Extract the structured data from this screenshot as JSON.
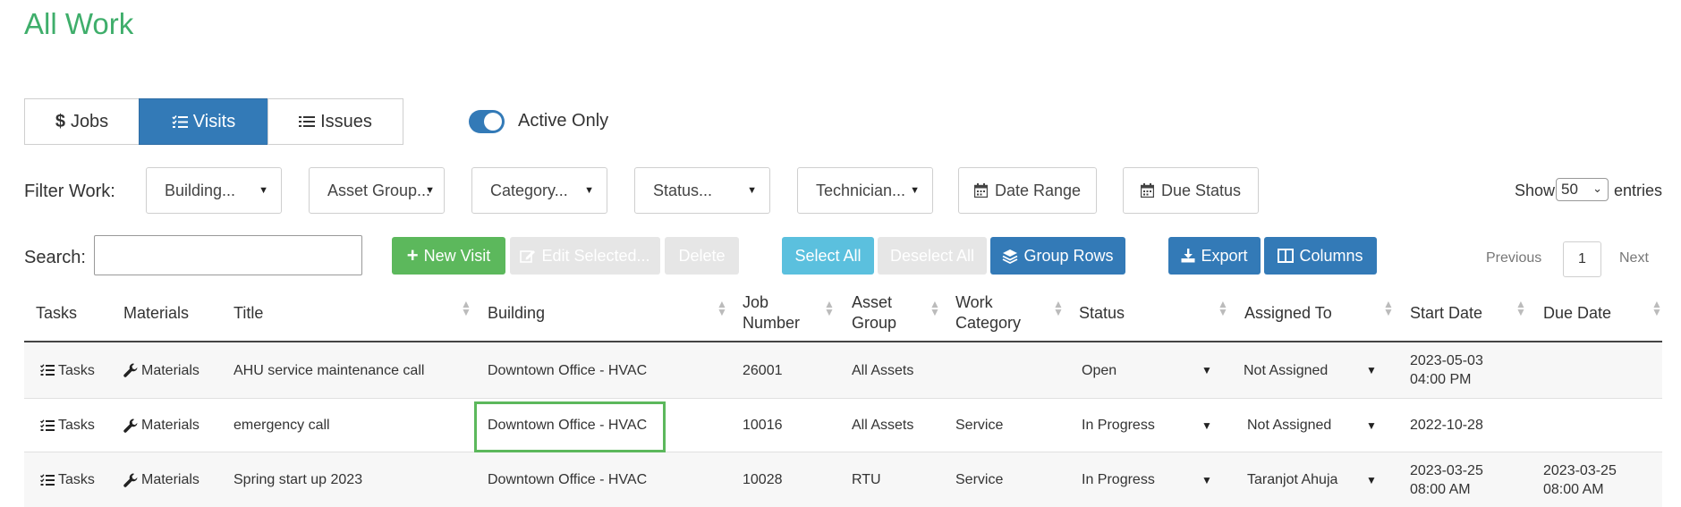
{
  "page_title": "All Work",
  "view_tabs": [
    {
      "label": "Jobs",
      "icon": "dollar-icon",
      "active": false
    },
    {
      "label": "Visits",
      "icon": "list-check-icon",
      "active": true
    },
    {
      "label": "Issues",
      "icon": "list-icon",
      "active": false
    }
  ],
  "active_only": {
    "label": "Active Only",
    "on": true
  },
  "filters": {
    "label": "Filter Work:",
    "building": "Building...",
    "asset_group": "Asset Group...",
    "category": "Category...",
    "status": "Status...",
    "technician": "Technician...",
    "date_range": "Date Range",
    "due_status": "Due Status"
  },
  "entries": {
    "show": "Show",
    "value": "50",
    "suffix": "entries"
  },
  "search": {
    "label": "Search:",
    "value": ""
  },
  "actions": {
    "new_visit": "New Visit",
    "edit_selected": "Edit Selected...",
    "delete": "Delete",
    "select_all": "Select All",
    "deselect_all": "Deselect All",
    "group_rows": "Group Rows",
    "export": "Export",
    "columns": "Columns"
  },
  "pagination": {
    "previous": "Previous",
    "page": "1",
    "next": "Next"
  },
  "columns": {
    "tasks": "Tasks",
    "materials": "Materials",
    "title": "Title",
    "building": "Building",
    "job_number_1": "Job",
    "job_number_2": "Number",
    "asset_group_1": "Asset",
    "asset_group_2": "Group",
    "work_category_1": "Work",
    "work_category_2": "Category",
    "status": "Status",
    "assigned_to": "Assigned To",
    "start_date": "Start Date",
    "due_date": "Due Date"
  },
  "rows": [
    {
      "tasks": "Tasks",
      "materials": "Materials",
      "title": "AHU service maintenance call",
      "building": "Downtown Office - HVAC",
      "job_number": "26001",
      "asset_group": "All Assets",
      "work_category": "",
      "status": "Open",
      "assigned_to": "Not Assigned",
      "start_date_1": "2023-05-03",
      "start_date_2": "04:00 PM",
      "due_date_1": "",
      "due_date_2": ""
    },
    {
      "tasks": "Tasks",
      "materials": "Materials",
      "title": "emergency call",
      "building": "Downtown Office - HVAC",
      "job_number": "10016",
      "asset_group": "All Assets",
      "work_category": "Service",
      "status": "In Progress",
      "assigned_to": "Not Assigned",
      "start_date_1": "2022-10-28",
      "start_date_2": "",
      "due_date_1": "",
      "due_date_2": ""
    },
    {
      "tasks": "Tasks",
      "materials": "Materials",
      "title": "Spring start up 2023",
      "building": "Downtown Office - HVAC",
      "job_number": "10028",
      "asset_group": "RTU",
      "work_category": "Service",
      "status": "In Progress",
      "assigned_to": "Taranjot Ahuja",
      "start_date_1": "2023-03-25",
      "start_date_2": "08:00 AM",
      "due_date_1": "2023-03-25",
      "due_date_2": "08:00 AM"
    }
  ],
  "colors": {
    "title_green": "#3fae6b",
    "primary": "#337ab7",
    "success": "#5cb85c",
    "info": "#5bc0de",
    "disabled": "#e6e6e6"
  }
}
